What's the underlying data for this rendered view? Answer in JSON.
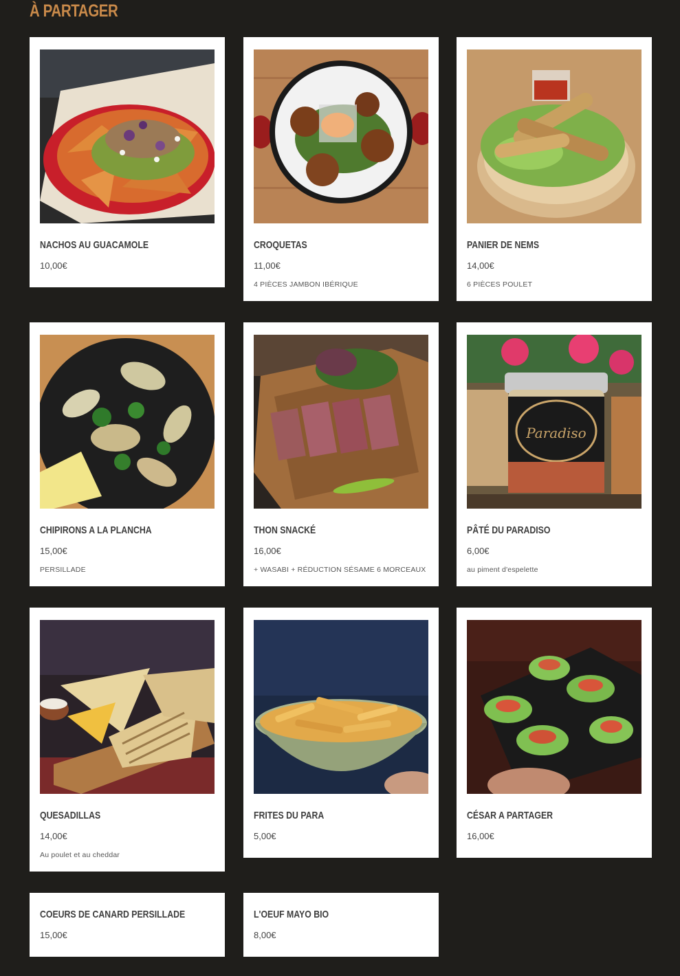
{
  "section": {
    "title": "À PARTAGER"
  },
  "items": [
    {
      "name": "NACHOS AU GUACAMOLE",
      "price": "10,00€",
      "desc": "",
      "photo": "nachos-photo"
    },
    {
      "name": "CROQUETAS",
      "price": "11,00€",
      "desc": "4 PIÈCES JAMBON IBÉRIQUE",
      "photo": "croquetas-photo"
    },
    {
      "name": "PANIER DE NEMS",
      "price": "14,00€",
      "desc": "6 PIÈCES POULET",
      "photo": "nems-photo"
    },
    {
      "name": "CHIPIRONS A LA PLANCHA",
      "price": "15,00€",
      "desc": "PERSILLADE",
      "photo": "chipirons-photo"
    },
    {
      "name": "THON SNACKÉ",
      "price": "16,00€",
      "desc": "+ WASABI + RÉDUCTION SÉSAME 6 MORCEAUX",
      "photo": "thon-photo"
    },
    {
      "name": "PÂTÉ DU PARADISO",
      "price": "6,00€",
      "desc": "au piment d'espelette",
      "photo": "pate-photo"
    },
    {
      "name": "QUESADILLAS",
      "price": "14,00€",
      "desc": "Au poulet et au cheddar",
      "photo": "quesadillas-photo"
    },
    {
      "name": "FRITES DU PARA",
      "price": "5,00€",
      "desc": "",
      "photo": "frites-photo"
    },
    {
      "name": "CÉSAR A PARTAGER",
      "price": "16,00€",
      "desc": "",
      "photo": "cesar-photo"
    },
    {
      "name": "COEURS DE CANARD PERSILLADE",
      "price": "15,00€",
      "desc": ""
    },
    {
      "name": "L'OEUF MAYO BIO",
      "price": "8,00€",
      "desc": ""
    }
  ],
  "photo_labels": {
    "pate_jar": "Paradiso"
  }
}
